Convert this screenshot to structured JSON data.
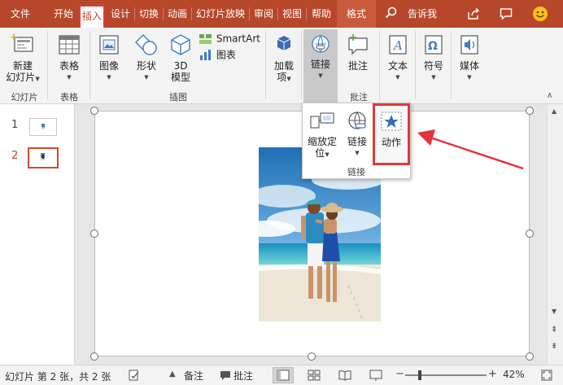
{
  "ribbon_tabs": [
    "文件",
    "开始",
    "插入",
    "设计",
    "切换",
    "动画",
    "幻灯片放映",
    "审阅",
    "视图",
    "帮助",
    "格式"
  ],
  "tell_me": "告诉我",
  "ribbon": {
    "new_slide": "新建",
    "new_slide2": "幻灯片",
    "table": "表格",
    "image": "图像",
    "shape": "形状",
    "model3d": "3D",
    "model3d2": "模型",
    "smartart": "SmartArt",
    "chart": "图表",
    "addin": "加载",
    "addin2": "项",
    "link": "链接",
    "comment": "批注",
    "text": "文本",
    "symbol": "符号",
    "media": "媒体",
    "groups": {
      "slides": "幻灯片",
      "tables": "表格",
      "illustrations": "插图",
      "comments": "批注"
    }
  },
  "popup": {
    "zoom": "缩放定",
    "zoom2": "位",
    "link": "链接",
    "action": "动作",
    "group_label": "链接"
  },
  "slides": {
    "items": [
      {
        "number": "1"
      },
      {
        "number": "2"
      }
    ]
  },
  "status": {
    "slide_info": "幻灯片 第 2 张，共 2 张",
    "notes": "备注",
    "comments": "批注",
    "zoom": "42%"
  },
  "colors": {
    "accent": "#b7472a",
    "highlight": "#e03a3a",
    "arrow": "#e8313a"
  }
}
